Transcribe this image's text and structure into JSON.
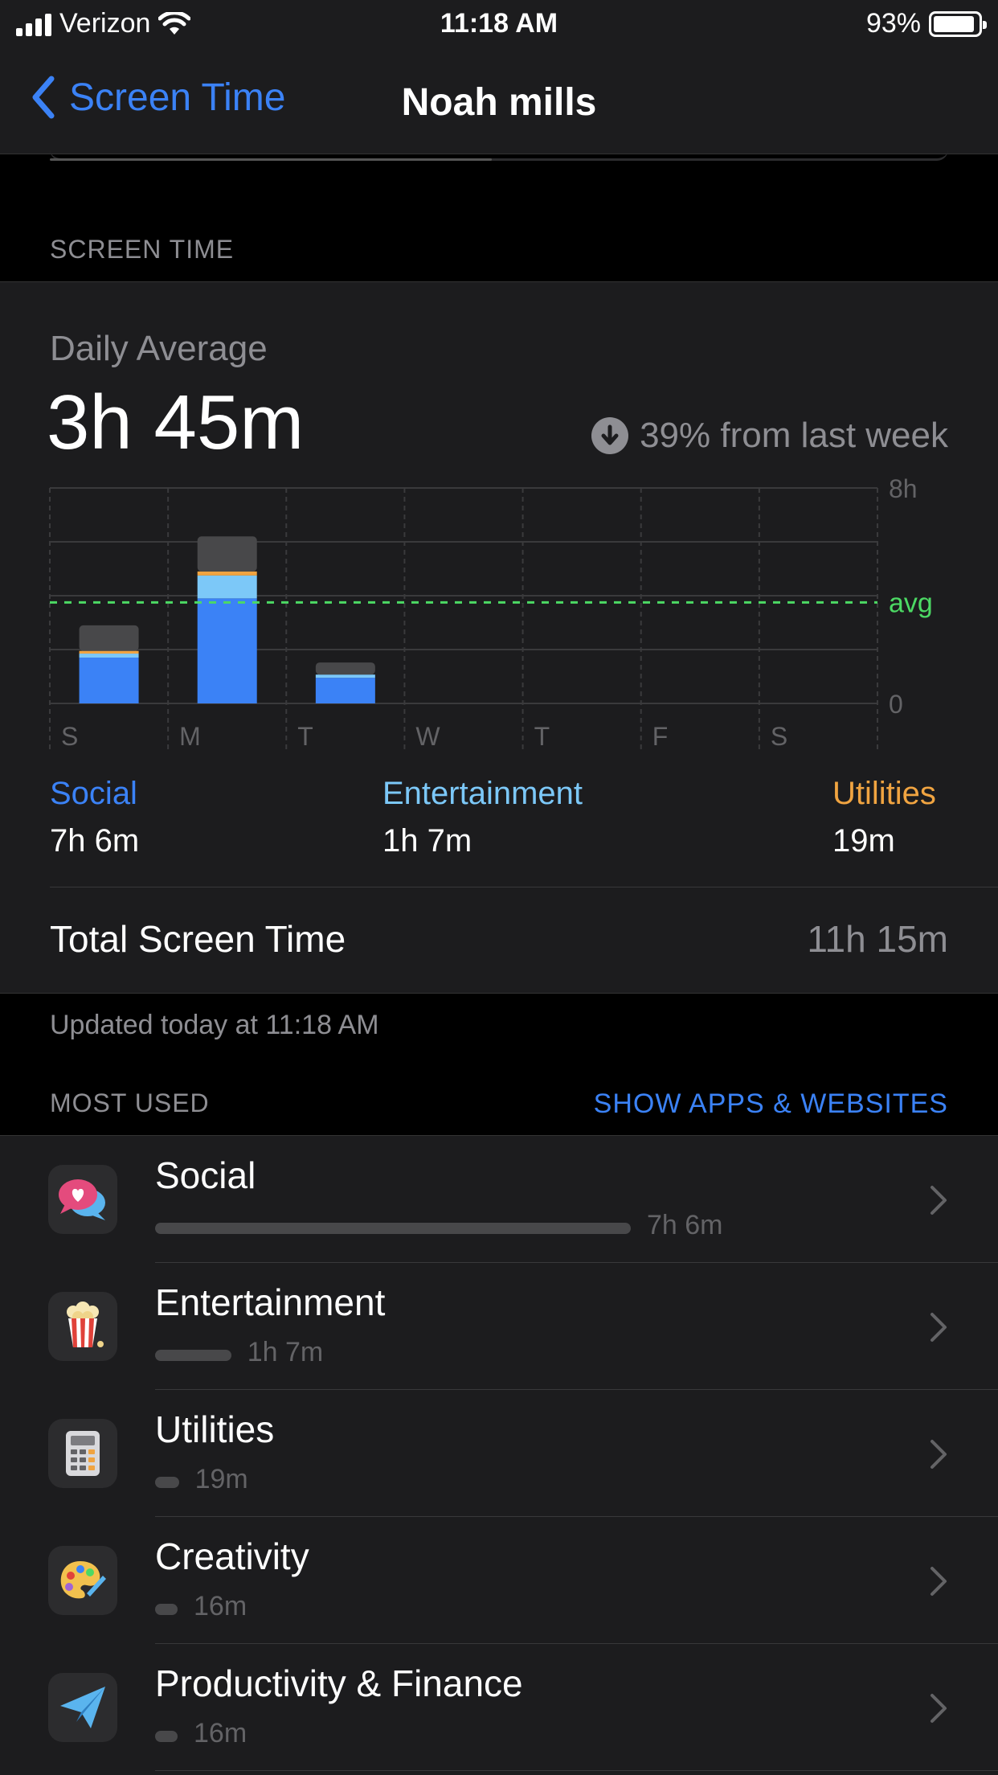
{
  "status_bar": {
    "carrier": "Verizon",
    "time": "11:18 AM",
    "battery": "93%"
  },
  "nav": {
    "back_label": "Screen Time",
    "title": "Noah mills"
  },
  "screen_time": {
    "section_label": "SCREEN TIME",
    "daily_average_label": "Daily Average",
    "daily_average_value": "3h 45m",
    "change_text": "39% from last week",
    "categories": [
      {
        "name": "Social",
        "value": "7h 6m",
        "color": "#3b82f6"
      },
      {
        "name": "Entertainment",
        "value": "1h 7m",
        "color": "#7cc8f8"
      },
      {
        "name": "Utilities",
        "value": "19m",
        "color": "#f0a441"
      }
    ],
    "total_label": "Total Screen Time",
    "total_value": "11h 15m",
    "updated_text": "Updated today at 11:18 AM"
  },
  "chart_data": {
    "type": "bar",
    "stacked": true,
    "categories": [
      "S",
      "M",
      "T",
      "W",
      "T",
      "F",
      "S"
    ],
    "series": [
      {
        "name": "Social",
        "color": "#3b82f6",
        "values": [
          1.7,
          3.9,
          0.95,
          0,
          0,
          0,
          0
        ]
      },
      {
        "name": "Entertainment",
        "color": "#7cc8f8",
        "values": [
          0.15,
          0.85,
          0.12,
          0,
          0,
          0,
          0
        ]
      },
      {
        "name": "Utilities",
        "color": "#f0a441",
        "values": [
          0.1,
          0.15,
          0,
          0,
          0,
          0,
          0
        ]
      },
      {
        "color": "#48484a",
        "values": [
          0.95,
          1.3,
          0.45,
          0,
          0,
          0,
          0
        ]
      }
    ],
    "avg": 3.75,
    "avg_label": "avg",
    "y_ticks": [
      "8h",
      "0"
    ],
    "ylim": [
      0,
      8
    ],
    "grid": true
  },
  "most_used": {
    "label": "MOST USED",
    "link": "SHOW APPS & WEBSITES",
    "items": [
      {
        "name": "Social",
        "duration": "7h 6m",
        "fraction": 1.0,
        "icon": "social-bubbles-icon"
      },
      {
        "name": "Entertainment",
        "duration": "1h 7m",
        "fraction": 0.16,
        "icon": "popcorn-icon"
      },
      {
        "name": "Utilities",
        "duration": "19m",
        "fraction": 0.05,
        "icon": "calculator-icon"
      },
      {
        "name": "Creativity",
        "duration": "16m",
        "fraction": 0.04,
        "icon": "palette-icon"
      },
      {
        "name": "Productivity & Finance",
        "duration": "16m",
        "fraction": 0.04,
        "icon": "paper-plane-icon"
      }
    ]
  }
}
